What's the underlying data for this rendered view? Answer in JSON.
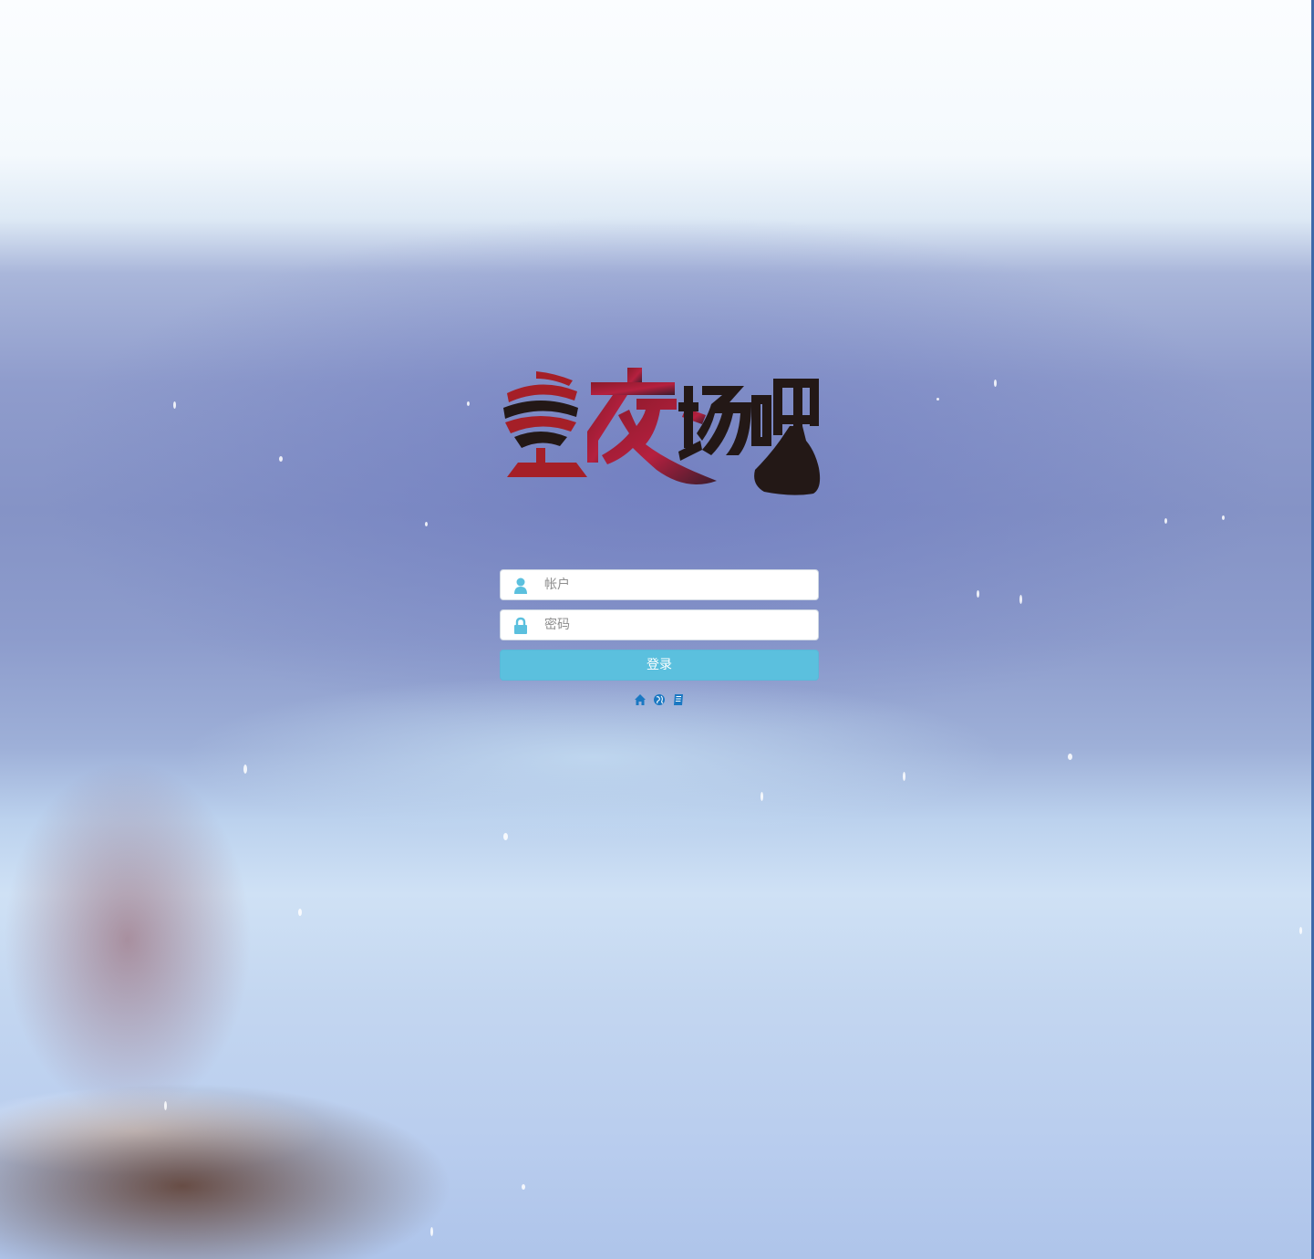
{
  "app": {
    "logo_text": "夜场吧"
  },
  "login": {
    "account_placeholder": "帐户",
    "password_placeholder": "密码",
    "submit_label": "登录"
  },
  "footer_links": [
    {
      "icon": "home-icon"
    },
    {
      "icon": "globe-icon"
    },
    {
      "icon": "book-icon"
    }
  ],
  "colors": {
    "button": "#5bc0de",
    "input_icon": "#5bc0de",
    "link_icon": "#1a78c2",
    "logo_red": "#b0202a",
    "logo_dark": "#231816"
  }
}
